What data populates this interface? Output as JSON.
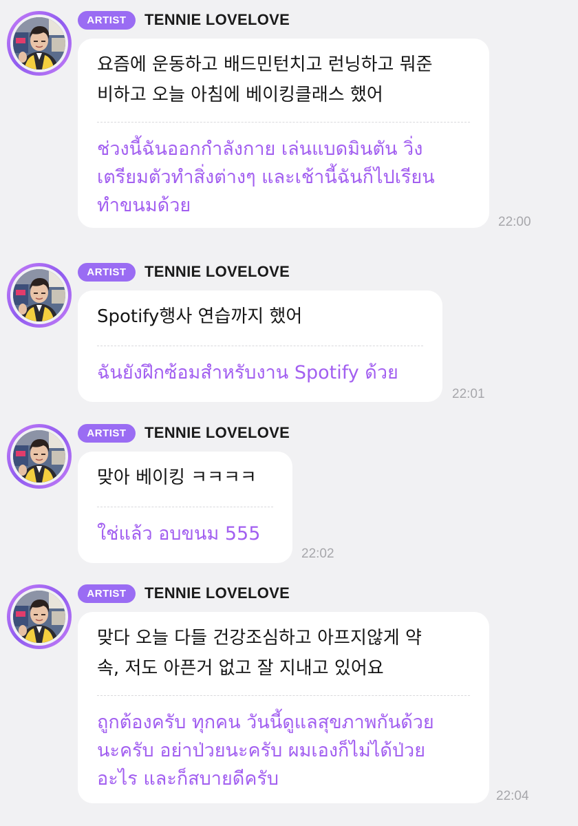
{
  "messages": [
    {
      "badge": "ARTIST",
      "sender": "TENNIE LOVELOVE",
      "korean": "요즘에 운동하고 배드민턴치고 런닝하고 뭐준\n비하고 오늘 아침에 베이킹클래스 했어",
      "thai": "ช่วงนี้ฉันออกกำลังกาย เล่นแบดมินตัน วิ่ง\nเตรียมตัวทำสิ่งต่างๆ และเช้านี้ฉันก็ไปเรียน\nทำขนมด้วย",
      "time": "22:00"
    },
    {
      "badge": "ARTIST",
      "sender": "TENNIE LOVELOVE",
      "korean": "Spotify행사 연습까지 했어",
      "thai": "ฉันยังฝึกซ้อมสำหรับงาน Spotify ด้วย",
      "time": "22:01"
    },
    {
      "badge": "ARTIST",
      "sender": "TENNIE LOVELOVE",
      "korean": "맞아 베이킹 ㅋㅋㅋㅋ",
      "thai": "ใช่แล้ว อบขนม 555",
      "time": "22:02"
    },
    {
      "badge": "ARTIST",
      "sender": "TENNIE LOVELOVE",
      "korean": "맞다 오늘 다들 건강조심하고 아프지않게 약\n속, 저도 아픈거 없고 잘 지내고 있어요",
      "thai": "ถูกต้องครับ ทุกคน วันนี้ดูแลสุขภาพกันด้วย\nนะครับ อย่าป่วยนะครับ ผมเองก็ไม่ได้ป่วย\nอะไร และก็สบายดีครับ",
      "time": "22:04"
    }
  ],
  "colors": {
    "background": "#f1f1f3",
    "badge": "#9a6cf3",
    "translation_text": "#a25ff0",
    "timestamp": "#a7a7ab",
    "bubble": "#ffffff"
  },
  "icons": {
    "avatar": "artist-profile-photo"
  }
}
